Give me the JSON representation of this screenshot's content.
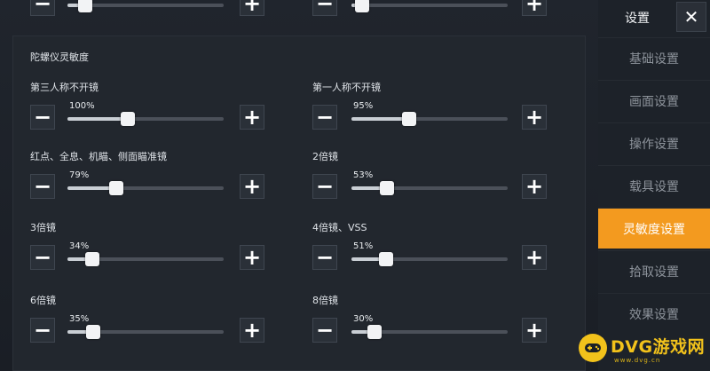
{
  "sidebar": {
    "title": "设置",
    "close_glyph": "✕",
    "items": [
      {
        "label": "基础设置"
      },
      {
        "label": "画面设置"
      },
      {
        "label": "操作设置"
      },
      {
        "label": "载具设置"
      },
      {
        "label": "灵敏度设置",
        "active": true
      },
      {
        "label": "拾取设置"
      },
      {
        "label": "效果设置"
      }
    ]
  },
  "section": {
    "title": "陀螺仪灵敏度"
  },
  "sliders": [
    {
      "label": "第三人称不开镜",
      "value": 1.0,
      "percent": "100%"
    },
    {
      "label": "第一人称不开镜",
      "value": 0.95,
      "percent": "95%"
    },
    {
      "label": "红点、全息、机瞄、侧面瞄准镜",
      "value": 0.79,
      "percent": "79%"
    },
    {
      "label": "2倍镜",
      "value": 0.53,
      "percent": "53%"
    },
    {
      "label": "3倍镜",
      "value": 0.34,
      "percent": "34%"
    },
    {
      "label": "4倍镜、VSS",
      "value": 0.51,
      "percent": "51%"
    },
    {
      "label": "6倍镜",
      "value": 0.35,
      "percent": "35%"
    },
    {
      "label": "8倍镜",
      "value": 0.3,
      "percent": "30%"
    }
  ],
  "controls": {
    "minus_glyph": "−",
    "plus_glyph": "+"
  },
  "watermark": {
    "text": "DVG游戏网",
    "sub": "www.dvg.cn"
  },
  "colors": {
    "accent": "#f39a1f",
    "watermark": "#f2c21b"
  },
  "icons": [
    "minus-icon",
    "plus-icon",
    "close-icon",
    "gamepad-icon"
  ]
}
